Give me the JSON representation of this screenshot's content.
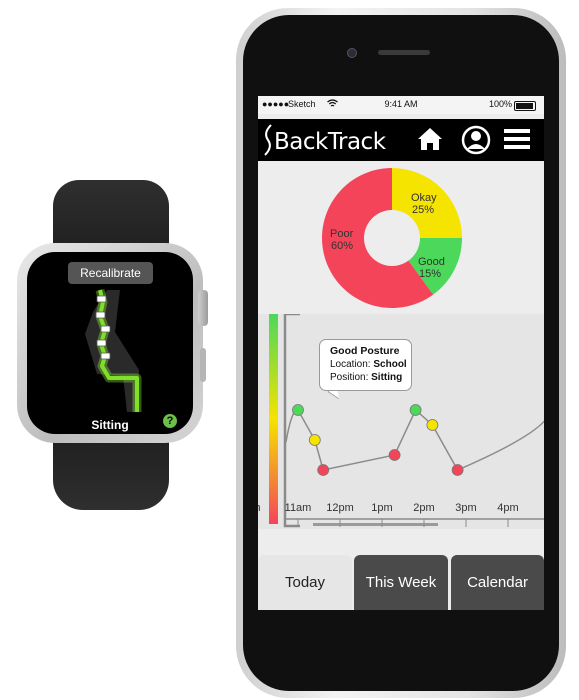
{
  "watch": {
    "recalibrate_label": "Recalibrate",
    "status_label": "Sitting",
    "help_glyph": "?",
    "accent_color": "#7ee02b"
  },
  "status_bar": {
    "carrier": "Sketch",
    "time": "9:41 AM",
    "battery": "100%"
  },
  "app": {
    "title": "BackTrack"
  },
  "donut": {
    "segments": [
      {
        "label": "Okay",
        "pct": "25%",
        "value": 25,
        "color": "#f5e300"
      },
      {
        "label": "Good",
        "pct": "15%",
        "value": 15,
        "color": "#4cd85a"
      },
      {
        "label": "Poor",
        "pct": "60%",
        "value": 60,
        "color": "#f4445a"
      }
    ]
  },
  "tooltip": {
    "title": "Good Posture",
    "location_label": "Location:",
    "location_value": "School",
    "position_label": "Position:",
    "position_value": "Sitting"
  },
  "chart_data": {
    "type": "line",
    "x": [
      "11am",
      "12pm",
      "1pm",
      "2pm",
      "3pm",
      "4pm"
    ],
    "x_ticks": [
      "m",
      "11am",
      "12pm",
      "1pm",
      "2pm",
      "3pm",
      "4pm"
    ],
    "points": [
      {
        "t": 11.0,
        "level": 3,
        "status": "good"
      },
      {
        "t": 11.4,
        "level": 2,
        "status": "okay"
      },
      {
        "t": 11.6,
        "level": 1,
        "status": "poor"
      },
      {
        "t": 13.3,
        "level": 1.5,
        "status": "poor"
      },
      {
        "t": 13.8,
        "level": 3,
        "status": "good"
      },
      {
        "t": 14.2,
        "level": 2.5,
        "status": "okay"
      },
      {
        "t": 14.8,
        "level": 1,
        "status": "poor"
      }
    ],
    "status_colors": {
      "good": "#4cd85a",
      "okay": "#f5e300",
      "poor": "#f4445a"
    }
  },
  "tabs": [
    {
      "label": "Today",
      "selected": true
    },
    {
      "label": "This Week",
      "selected": false
    },
    {
      "label": "Calendar",
      "selected": false
    }
  ]
}
